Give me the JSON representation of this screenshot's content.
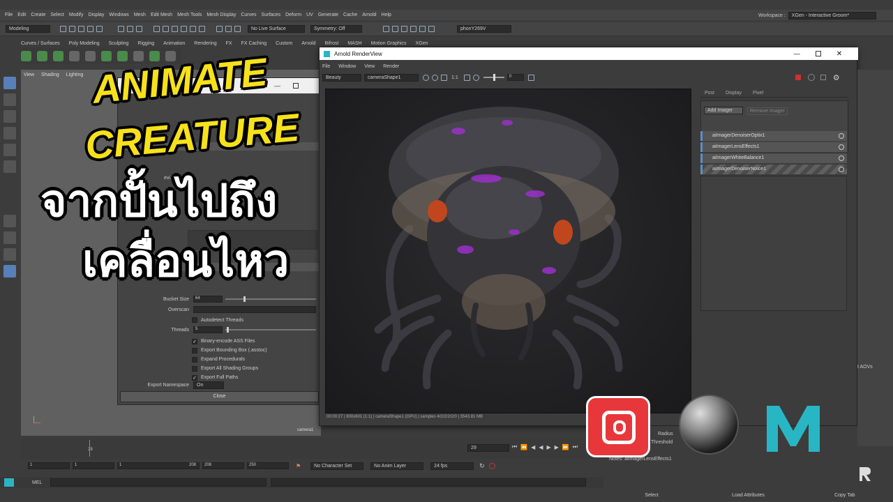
{
  "menubar": [
    "File",
    "Edit",
    "Create",
    "Select",
    "Modify",
    "Display",
    "Windows",
    "Mesh",
    "Edit Mesh",
    "Mesh Tools",
    "Mesh Display",
    "Curves",
    "Surfaces",
    "Deform",
    "UV",
    "Generate",
    "Cache",
    "Arnold",
    "Help"
  ],
  "workspace": {
    "label": "Workspace :",
    "value": "XGen - Interactive Groom*"
  },
  "toolbar": {
    "mode": "Modeling",
    "live_surface": "No Live Surface",
    "symmetry": "Symmetry: Off",
    "user": "phonY269V"
  },
  "shelf_tabs": [
    "Curves / Surfaces",
    "Poly Modeling",
    "Sculpting",
    "Rigging",
    "Animation",
    "Rendering",
    "FX",
    "FX Caching",
    "Custom",
    "Arnold",
    "Bifrost",
    "MASH",
    "Motion Graphics",
    "XGen"
  ],
  "viewport": {
    "menu": [
      "View",
      "Shading",
      "Lighting"
    ],
    "camera_label": "camera1"
  },
  "dialog": {
    "device_label": "evice Sel",
    "bucket_size_label": "Bucket Size",
    "bucket_size_value": "64",
    "overscan_label": "Overscan",
    "autodetect_threads": "Autodetect Threads",
    "threads_label": "Threads",
    "threads_value": "5",
    "options": [
      {
        "label": "Binary-encode ASS Files",
        "checked": true
      },
      {
        "label": "Export Bounding Box (.asstoc)",
        "checked": false
      },
      {
        "label": "Expand Procedurals",
        "checked": false
      },
      {
        "label": "Export All Shading Groups",
        "checked": false
      },
      {
        "label": "Export Full Paths",
        "checked": true
      }
    ],
    "export_namespace_label": "Export Namespace",
    "export_namespace_value": "On",
    "close_label": "Close"
  },
  "renderview": {
    "title": "Arnold RenderView",
    "menu": [
      "File",
      "Window",
      "View",
      "Render"
    ],
    "aov": "Beauty",
    "camera": "cameraShape1",
    "ratio": "1:1",
    "exposure": "0",
    "status": "00:00:27 | 800x601 (1:1) | cameraShape1 (GPU) | samples 4/2/2/2/2/0 | 3543.81 MB",
    "right_tabs": [
      "Post",
      "Display",
      "Pixel"
    ],
    "add_imager": "Add Imager",
    "remove_imager": "Remove Imager",
    "imagers": [
      "aiImagerDenoiserOptix1",
      "aiImagerLensEffects1",
      "aiImagerWhiteBalance1",
      "aiImagerDenoiserNoice1"
    ]
  },
  "overlay": {
    "line1": "ANIMATE",
    "line2": "CREATURE",
    "line3": "จากปั้นไปถึง",
    "line4": "เคลื่อนไหว"
  },
  "timeline": {
    "current_frame": "29",
    "frame_field": "29",
    "tick_label": "29"
  },
  "range": {
    "start": "1",
    "start2": "1",
    "range_start": "1",
    "range_end": "208",
    "end": "208",
    "end2": "250",
    "character_set": "No Character Set",
    "anim_layer": "No Anim Layer",
    "fps": "24 fps"
  },
  "melbar": {
    "label": "MEL"
  },
  "attr_panel": {
    "radius_label": "Radius",
    "threshold_label": "Threshold",
    "aovs_label": "t AOVs",
    "notes": "Notes:  aiImagerLensEffects1"
  },
  "bottom_buttons": [
    "Select",
    "Load Attributes",
    "Copy Tab"
  ],
  "colors": {
    "accent_blue": "#5b8fc7",
    "title_yellow": "#f7e11b",
    "substance_red": "#e8373a",
    "maya_teal": "#29b6c4"
  }
}
